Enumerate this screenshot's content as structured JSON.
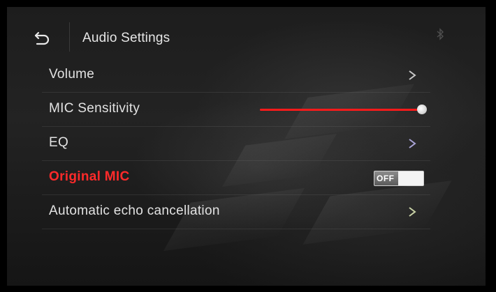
{
  "header": {
    "title": "Audio Settings",
    "back_icon": "back-arrow-icon",
    "status_icon": "bluetooth-icon"
  },
  "menu": {
    "items": [
      {
        "label": "Volume",
        "control": "chevron",
        "icon": "chevron-right-icon",
        "active": false
      },
      {
        "label": "MIC Sensitivity",
        "control": "slider",
        "level": 1.0,
        "active": false
      },
      {
        "label": "EQ",
        "control": "chevron",
        "icon": "chevron-right-icon",
        "active": false
      },
      {
        "label": "Original MIC",
        "control": "toggle",
        "toggle_text": "OFF",
        "on": false,
        "active": true
      },
      {
        "label": "Automatic echo cancellation",
        "control": "chevron",
        "icon": "chevron-right-icon",
        "active": false
      }
    ]
  },
  "colors": {
    "accent": "#ff2a2a",
    "text": "#e2e2e2",
    "slider_fill": "#ff1a1a",
    "background": "#1d1d1d"
  }
}
